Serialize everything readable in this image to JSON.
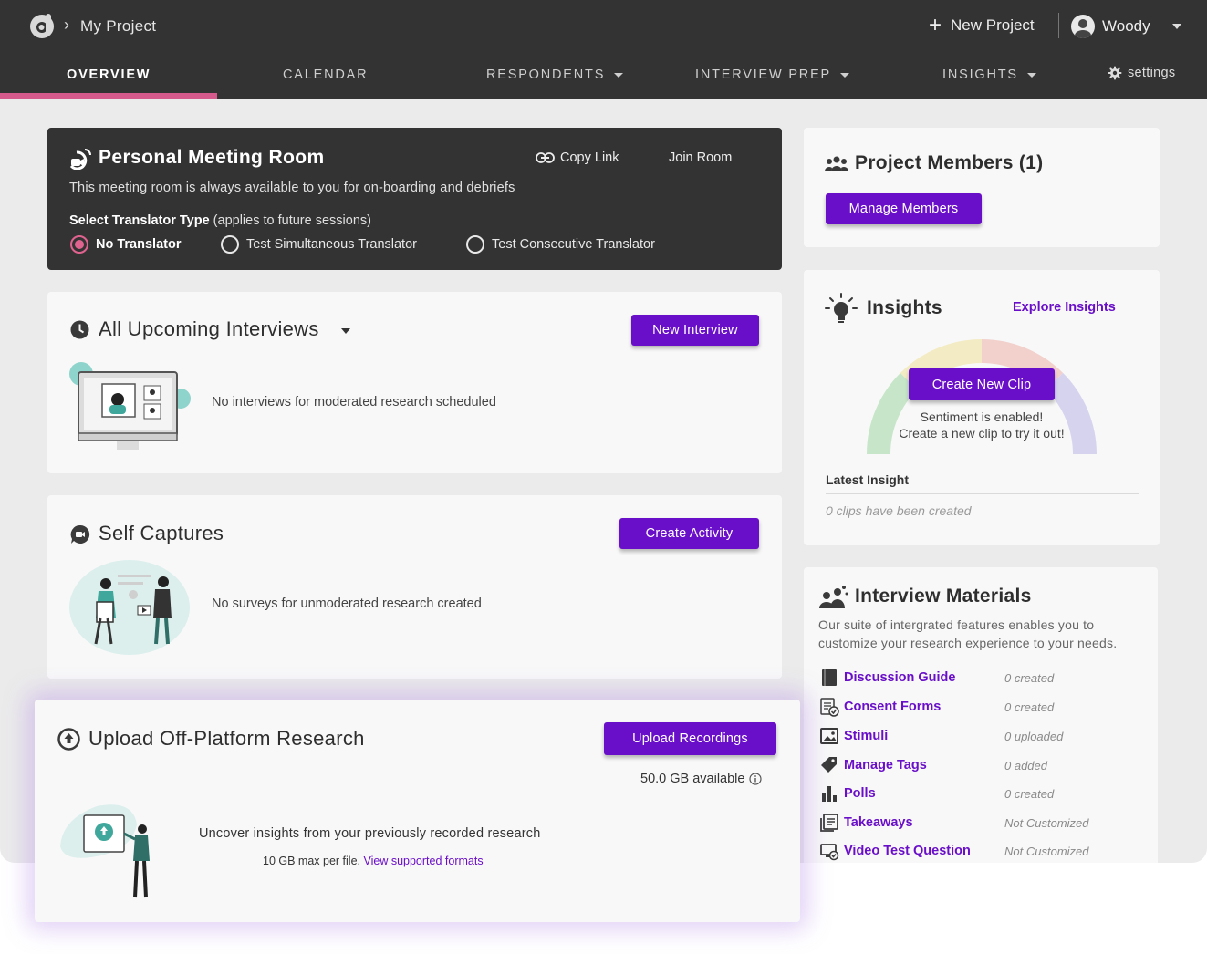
{
  "header": {
    "project_name": "My Project",
    "new_project_label": "New Project",
    "user_name": "Woody"
  },
  "nav": {
    "tabs": [
      {
        "label": "OVERVIEW"
      },
      {
        "label": "CALENDAR"
      },
      {
        "label": "RESPONDENTS"
      },
      {
        "label": "INTERVIEW PREP"
      },
      {
        "label": "INSIGHTS"
      }
    ],
    "settings_label": "settings"
  },
  "meeting_room": {
    "title": "Personal Meeting Room",
    "copy_link_label": "Copy Link",
    "join_room_label": "Join Room",
    "description": "This meeting room is always available to you for on-boarding and debriefs",
    "translator_label_bold": "Select Translator Type",
    "translator_label_rest": " (applies to future sessions)",
    "options": [
      "No Translator",
      "Test Simultaneous Translator",
      "Test Consecutive Translator"
    ],
    "selected": "No Translator"
  },
  "interviews": {
    "title": "All Upcoming Interviews",
    "button_label": "New Interview",
    "empty_text": "No interviews for moderated research scheduled"
  },
  "self_captures": {
    "title": "Self Captures",
    "button_label": "Create Activity",
    "empty_text": "No surveys for unmoderated research created"
  },
  "upload": {
    "title": "Upload Off-Platform Research",
    "button_label": "Upload Recordings",
    "available": "50.0 GB available",
    "description": "Uncover insights from your previously recorded research",
    "limit_text": "10 GB max per file.",
    "formats_link": "View supported formats"
  },
  "members": {
    "title": "Project Members (1)",
    "button_label": "Manage Members"
  },
  "insights": {
    "title": "Insights",
    "explore_label": "Explore Insights",
    "button_label": "Create New Clip",
    "line1": "Sentiment is enabled!",
    "line2": "Create a new clip to try it out!",
    "latest_label": "Latest Insight",
    "empty_text": "0 clips have been created",
    "gauge_colors": [
      "#c7e6c9",
      "#f3ebc4",
      "#f2d1cc",
      "#d6d3ef"
    ]
  },
  "materials": {
    "title": "Interview Materials",
    "description_1": "Our suite of intergrated features enables you to",
    "description_2": "customize your research experience to your needs.",
    "items": [
      {
        "name": "Discussion Guide",
        "status": "0 created",
        "icon": "book-icon"
      },
      {
        "name": "Consent Forms",
        "status": "0 created",
        "icon": "form-check-icon"
      },
      {
        "name": "Stimuli",
        "status": "0 uploaded",
        "icon": "image-icon"
      },
      {
        "name": "Manage Tags",
        "status": "0 added",
        "icon": "tag-icon"
      },
      {
        "name": "Polls",
        "status": "0 created",
        "icon": "bar-chart-icon"
      },
      {
        "name": "Takeaways",
        "status": "Not Customized",
        "icon": "notes-icon"
      },
      {
        "name": "Video Test Question",
        "status": "Not Customized",
        "icon": "video-check-icon"
      }
    ]
  },
  "colors": {
    "accent": "#6a0fc9",
    "header_bg": "#333333",
    "tab_indicator": "#d65a8c"
  }
}
